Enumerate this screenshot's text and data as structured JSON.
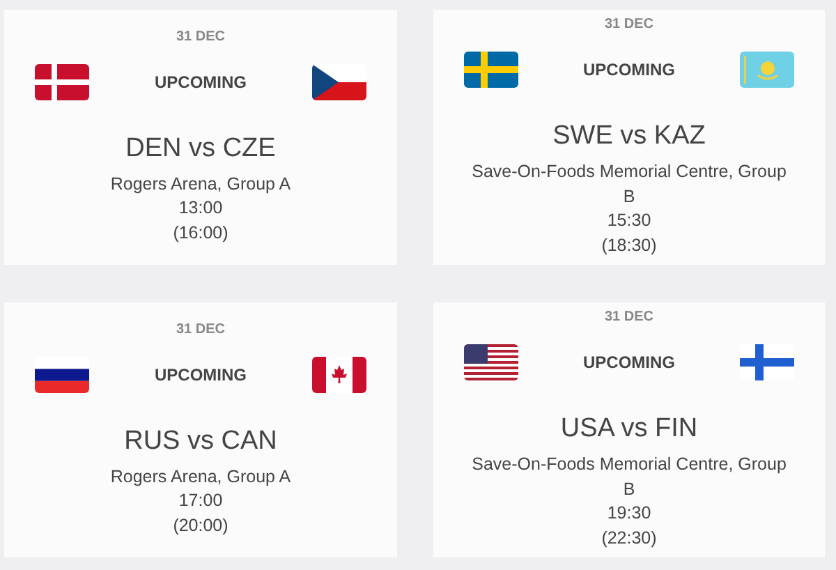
{
  "matches": [
    {
      "date": "31 DEC",
      "status": "UPCOMING",
      "title": "DEN vs CZE",
      "venue": "Rogers Arena, Group A",
      "time": "13:00",
      "local_time": "(16:00)"
    },
    {
      "date": "31 DEC",
      "status": "UPCOMING",
      "title": "SWE vs KAZ",
      "venue": "Save-On-Foods Memorial Centre, Group B",
      "time": "15:30",
      "local_time": "(18:30)"
    },
    {
      "date": "31 DEC",
      "status": "UPCOMING",
      "title": "RUS vs CAN",
      "venue": "Rogers Arena, Group A",
      "time": "17:00",
      "local_time": "(20:00)"
    },
    {
      "date": "31 DEC",
      "status": "UPCOMING",
      "title": "USA vs FIN",
      "venue": "Save-On-Foods Memorial Centre, Group B",
      "time": "19:30",
      "local_time": "(22:30)"
    }
  ]
}
